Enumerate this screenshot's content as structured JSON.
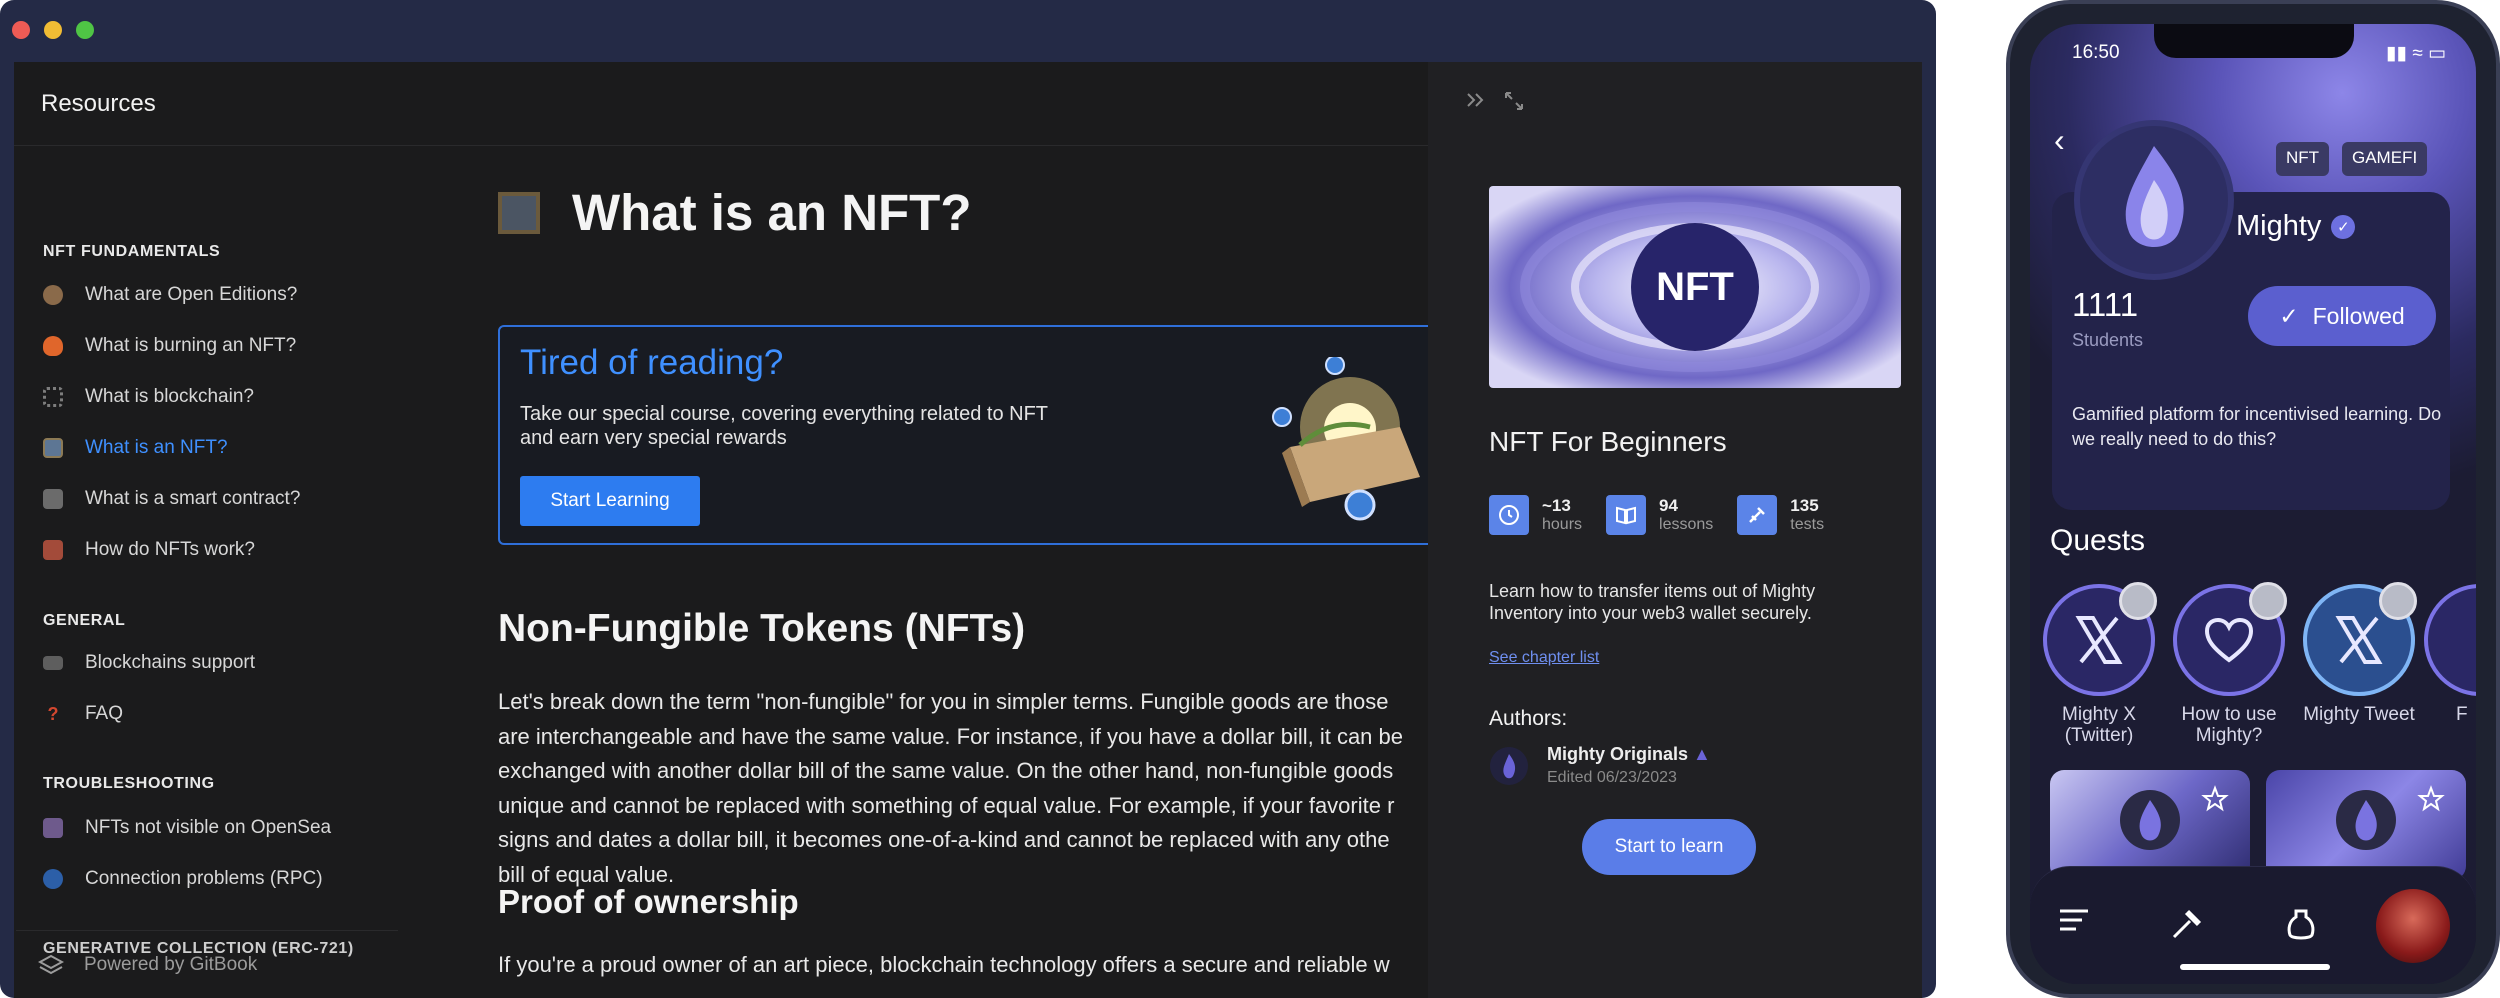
{
  "sidebar": {
    "title": "Resources",
    "sections": [
      {
        "title": "NFT FUNDAMENTALS",
        "items": [
          "What are Open Editions?",
          "What is burning an NFT?",
          "What is blockchain?",
          "What is an NFT?",
          "What is a smart contract?",
          "How do NFTs work?"
        ]
      },
      {
        "title": "GENERAL",
        "items": [
          "Blockchains support",
          "FAQ"
        ]
      },
      {
        "title": "TROUBLESHOOTING",
        "items": [
          "NFTs not visible on OpenSea",
          "Connection problems (RPC)"
        ]
      },
      {
        "title": "GENERATIVE COLLECTION (ERC-721)",
        "items": []
      }
    ],
    "active_item": "What is an NFT?",
    "powered_by": "Powered by GitBook"
  },
  "article": {
    "title": "What is an NFT?",
    "promo": {
      "title": "Tired of reading?",
      "description": "Take our special course, covering everything related to NFT and earn very special rewards",
      "button": "Start Learning"
    },
    "h2_1": "Non-Fungible Tokens (NFTs)",
    "paragraph_1": "Let's break down the term \"non-fungible\" for you in simpler terms. Fungible goods are those that are interchangeable and have the same value. For instance, if you have a dollar bill, it can be exchanged with another dollar bill of the same value. On the other hand, non-fungible goods are unique and cannot be replaced with something of equal value. For example, if your favorite r... signs and dates a dollar bill, it becomes one-of-a-kind and cannot be replaced with any othe... bill of equal value.",
    "paragraph_1_lines": [
      "Let's break down the term \"non-fungible\" for you in simpler terms. Fungible goods are those",
      "are interchangeable and have the same value. For instance, if you have a dollar bill, it can be",
      "exchanged with another dollar bill of the same value. On the other hand, non-fungible goods",
      "unique and cannot be replaced with something of equal value. For example, if your favorite r",
      "signs and dates a dollar bill, it becomes one-of-a-kind and cannot be replaced with any othe",
      "bill of equal value."
    ],
    "h2_2": "Proof of ownership",
    "paragraph_2": "If you're a proud owner of an art piece, blockchain technology offers a secure and reliable w"
  },
  "course": {
    "image_label": "NFT",
    "title": "NFT For Beginners",
    "stats": [
      {
        "value": "~13",
        "label": "hours",
        "icon": "clock-icon"
      },
      {
        "value": "94",
        "label": "lessons",
        "icon": "book-icon"
      },
      {
        "value": "135",
        "label": "tests",
        "icon": "puzzle-icon"
      }
    ],
    "description": "Learn how to transfer items out of Mighty Inventory into your web3 wallet securely.",
    "chapter_link": "See chapter list",
    "authors_label": "Authors:",
    "author_name": "Mighty Originals",
    "author_edited": "Edited 06/23/2023",
    "cta": "Start to learn"
  },
  "phone": {
    "time": "16:50",
    "tags": [
      "NFT",
      "GAMEFI"
    ],
    "name": "Mighty",
    "students_count": "1111",
    "students_label": "Students",
    "follow_button": "Followed",
    "description": "Gamified platform for incentivised learning. Do we really need to do this?",
    "quests_title": "Quests",
    "quests": [
      {
        "label": "Mighty X (Twitter)",
        "icon": "x-logo-icon"
      },
      {
        "label": "How to use Mighty?",
        "icon": "heart-icon"
      },
      {
        "label": "Mighty Tweet",
        "icon": "x-logo-icon"
      },
      {
        "label": "F",
        "icon": "quest-icon"
      }
    ]
  },
  "colors": {
    "accent_blue": "#3f90ff",
    "panel_bg": "#202023",
    "mighty_purple": "#5b5fcf"
  }
}
